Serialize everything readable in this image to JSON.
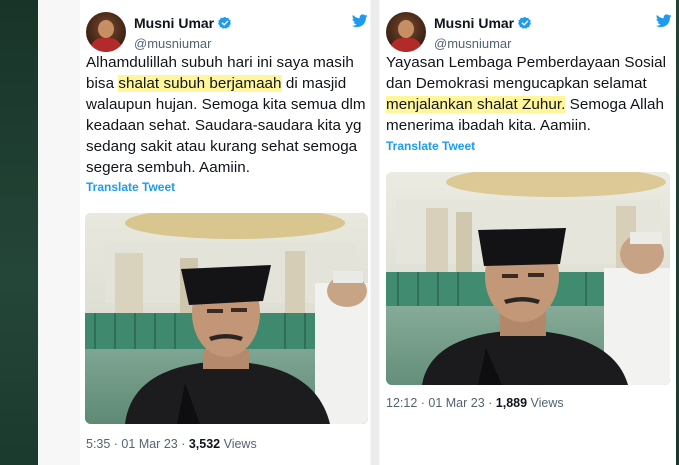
{
  "tweets": [
    {
      "author_name": "Musni Umar",
      "author_handle": "@musniumar",
      "text_before": "Alhamdulillah subuh hari ini saya masih bisa ",
      "text_highlight": "shalat subuh berjamaah",
      "text_after": " di masjid walaupun hujan. Semoga kita semua dlm keadaan sehat. Saudara-saudara kita yg sedang sakit atau kurang sehat semoga segera sembuh. Aamiin.",
      "translate_label": "Translate Tweet",
      "time": "5:35 · 01 Mar 23 · ",
      "views_count": "3,532",
      "views_label": " Views"
    },
    {
      "author_name": "Musni Umar",
      "author_handle": "@musniumar",
      "text_before": "Yayasan Lembaga Pemberdayaan Sosial dan Demokrasi mengucapkan selamat ",
      "text_highlight": "menjalankan shalat Zuhur.",
      "text_after": " Semoga Allah menerima ibadah kita. Aamiin.",
      "translate_label": "Translate Tweet",
      "time": "12:12 · 01 Mar 23 · ",
      "views_count": "1,889",
      "views_label": " Views"
    }
  ],
  "colors": {
    "highlight": "#fff59a",
    "link": "#1d9bf0",
    "verified": "#1d9bf0",
    "muted": "#536471"
  }
}
